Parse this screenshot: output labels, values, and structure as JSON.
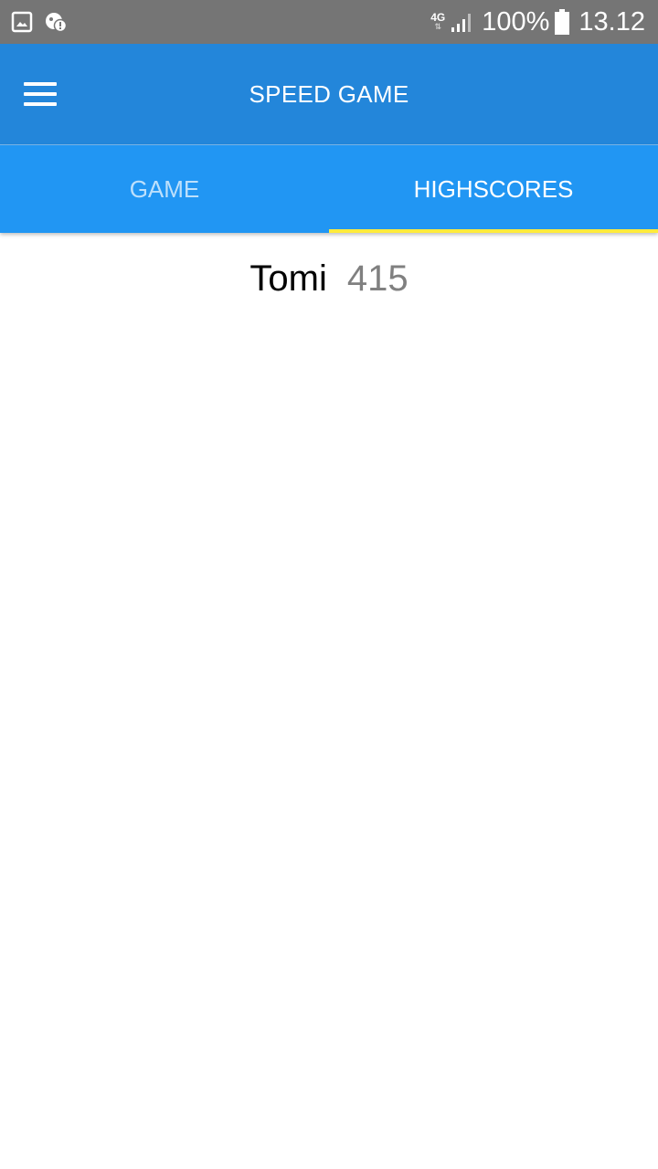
{
  "status_bar": {
    "left_icons": [
      "image-icon",
      "alert-bubble-icon"
    ],
    "network": "4G",
    "battery_percent": "100%",
    "time": "13.12"
  },
  "app_bar": {
    "title": "SPEED GAME",
    "menu_icon": "hamburger-menu-icon"
  },
  "tabs": [
    {
      "label": "GAME",
      "active": false
    },
    {
      "label": "HIGHSCORES",
      "active": true
    }
  ],
  "highscores": [
    {
      "name": "Tomi",
      "score": "415"
    }
  ],
  "colors": {
    "status_bar": "#757575",
    "app_bar": "#2386da",
    "tab_bar": "#2196f3",
    "tab_indicator": "#ffeb3b",
    "score_text": "#808080"
  }
}
